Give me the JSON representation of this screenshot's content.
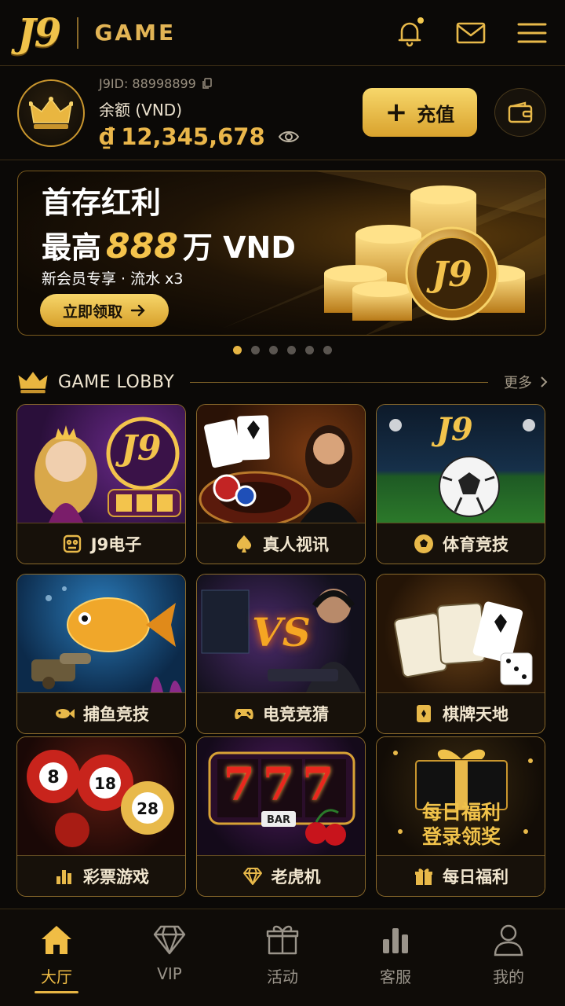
{
  "header": {
    "logo": "J9",
    "game": "GAME",
    "icons": [
      "bell-icon",
      "mail-icon",
      "menu-icon"
    ]
  },
  "account": {
    "id": "J9ID: 88998899",
    "label": "余额 (VND)",
    "currency": "₫",
    "balance": "12,345,678",
    "deposit_label": "充值"
  },
  "banner": {
    "title": "首存红利",
    "line2_prefix": "最高",
    "amount": "888",
    "line2_suffix": "万 VND",
    "subtitle": "新会员专享 · 流水 x3",
    "cta": "立即领取",
    "coin_text": "J9",
    "slides": 6,
    "active_slide": 0
  },
  "lobby": {
    "title": "GAME LOBBY",
    "more": "更多",
    "tiles": [
      {
        "label": "J9电子",
        "icon": "slot-machine-icon",
        "art_text": "J9"
      },
      {
        "label": "真人视讯",
        "icon": "spade-icon"
      },
      {
        "label": "体育竞技",
        "icon": "soccer-ball-icon",
        "art_text": "J9"
      },
      {
        "label": "捕鱼竞技",
        "icon": "fish-icon"
      },
      {
        "label": "电竞竞猜",
        "icon": "gamepad-icon",
        "art_text": "VS"
      },
      {
        "label": "棋牌天地",
        "icon": "card-icon"
      },
      {
        "label": "彩票游戏",
        "icon": "bar-chart-icon",
        "balls": [
          "8",
          "18",
          "28"
        ]
      },
      {
        "label": "老虎机",
        "icon": "diamond-icon",
        "art_text": "777",
        "bar_text": "BAR"
      },
      {
        "label": "每日福利",
        "icon": "gift-icon",
        "art_line1": "每日福利",
        "art_line2": "登录领奖"
      }
    ]
  },
  "nav": [
    {
      "label": "大厅",
      "icon": "home-icon",
      "active": true
    },
    {
      "label": "VIP",
      "icon": "diamond-icon"
    },
    {
      "label": "活动",
      "icon": "gift-icon"
    },
    {
      "label": "客服",
      "icon": "bar-chart-icon"
    },
    {
      "label": "我的",
      "icon": "user-icon"
    }
  ],
  "colors": {
    "accent": "#e8b94a",
    "background": "#0b0907",
    "border": "#8b6a2b"
  }
}
